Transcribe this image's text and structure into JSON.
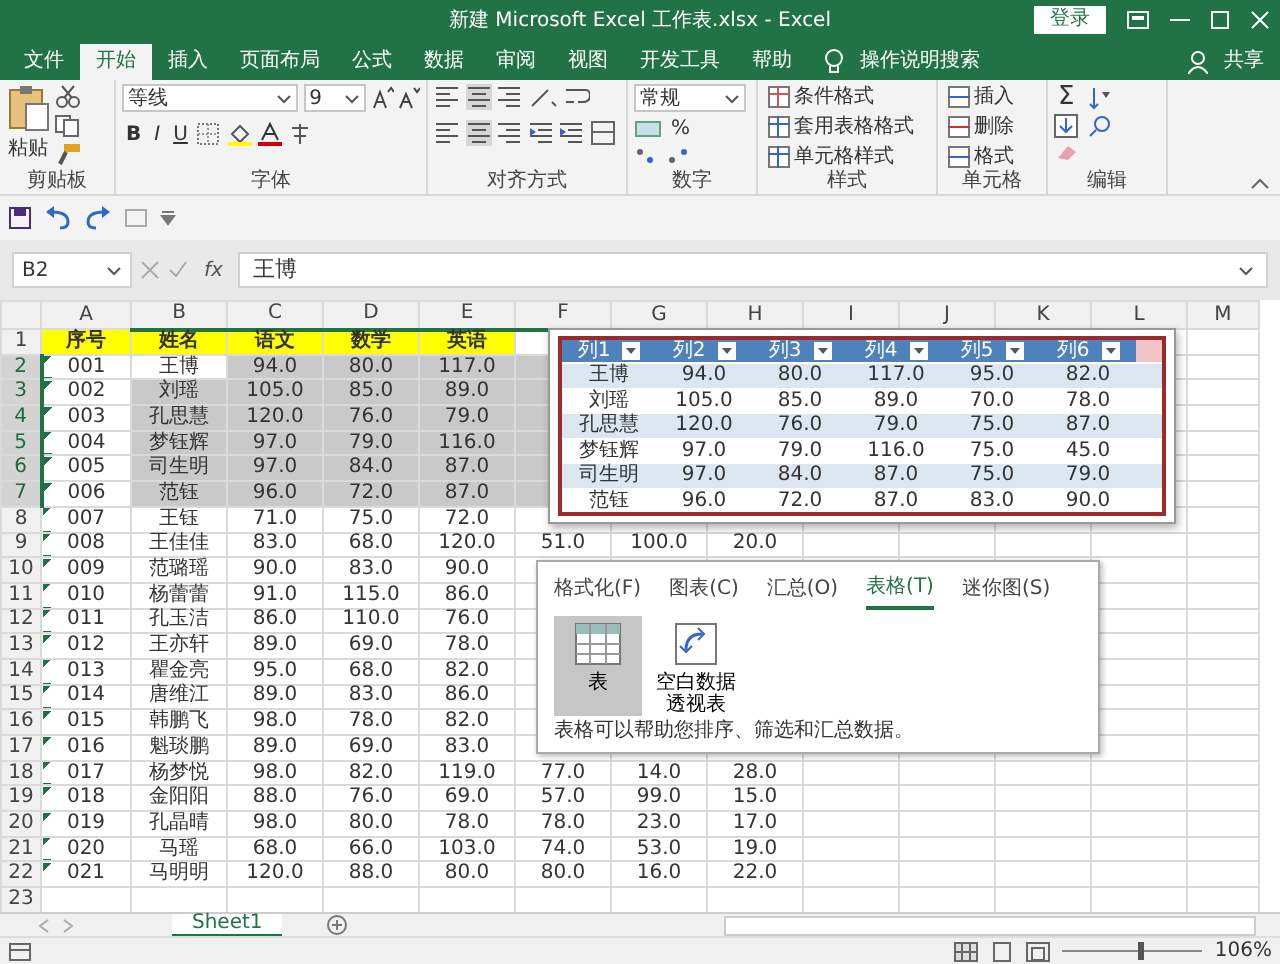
{
  "window": {
    "title": "新建 Microsoft Excel 工作表.xlsx  -  Excel",
    "sign_in": "登录"
  },
  "ribbon_tabs": [
    {
      "label": "文件",
      "selected": false
    },
    {
      "label": "开始",
      "selected": true
    },
    {
      "label": "插入",
      "selected": false
    },
    {
      "label": "页面布局",
      "selected": false
    },
    {
      "label": "公式",
      "selected": false
    },
    {
      "label": "数据",
      "selected": false
    },
    {
      "label": "审阅",
      "selected": false
    },
    {
      "label": "视图",
      "selected": false
    },
    {
      "label": "开发工具",
      "selected": false
    },
    {
      "label": "帮助",
      "selected": false
    }
  ],
  "tell_me": "操作说明搜索",
  "share": "共享",
  "ribbon": {
    "clipboard": {
      "paste": "粘贴",
      "label": "剪贴板"
    },
    "font": {
      "name": "等线",
      "size": "9",
      "styles": [
        "B",
        "I",
        "U"
      ],
      "label": "字体"
    },
    "alignment": {
      "label": "对齐方式"
    },
    "number": {
      "format": "常规",
      "percent": "%",
      "label": "数字"
    },
    "styles": {
      "items": [
        "条件格式",
        "套用表格格式",
        "单元格样式"
      ],
      "label": "样式"
    },
    "cells": {
      "items": [
        "插入",
        "删除",
        "格式"
      ],
      "label": "单元格"
    },
    "editing": {
      "sum": "Σ",
      "label": "编辑"
    }
  },
  "formula_bar": {
    "name_box": "B2",
    "function_label": "fx",
    "value": "王博"
  },
  "columns": [
    {
      "label": "A",
      "selected": false
    },
    {
      "label": "B",
      "selected": true
    },
    {
      "label": "C",
      "selected": true
    },
    {
      "label": "D",
      "selected": true
    },
    {
      "label": "E",
      "selected": true
    },
    {
      "label": "F",
      "selected": true
    },
    {
      "label": "G",
      "selected": false
    },
    {
      "label": "H",
      "selected": false
    },
    {
      "label": "I",
      "selected": false
    },
    {
      "label": "J",
      "selected": false
    },
    {
      "label": "K",
      "selected": false
    },
    {
      "label": "L",
      "selected": false
    },
    {
      "label": "M",
      "selected": false
    }
  ],
  "rows": [
    {
      "number": "1",
      "kind": "header",
      "selected": false,
      "cells": [
        "序号",
        "姓名",
        "语文",
        "数学",
        "英语"
      ]
    },
    {
      "number": "2",
      "kind": "data",
      "selected": true,
      "active": true,
      "cells": [
        "001",
        "王博",
        "94.0",
        "80.0",
        "117.0"
      ]
    },
    {
      "number": "3",
      "kind": "data",
      "selected": true,
      "cells": [
        "002",
        "刘瑶",
        "105.0",
        "85.0",
        "89.0"
      ]
    },
    {
      "number": "4",
      "kind": "data",
      "selected": true,
      "cells": [
        "003",
        "孔思慧",
        "120.0",
        "76.0",
        "79.0"
      ]
    },
    {
      "number": "5",
      "kind": "data",
      "selected": true,
      "cells": [
        "004",
        "梦钰辉",
        "97.0",
        "79.0",
        "116.0"
      ]
    },
    {
      "number": "6",
      "kind": "data",
      "selected": true,
      "cells": [
        "005",
        "司生明",
        "97.0",
        "84.0",
        "87.0"
      ]
    },
    {
      "number": "7",
      "kind": "data",
      "selected": true,
      "cells": [
        "006",
        "范钰",
        "96.0",
        "72.0",
        "87.0"
      ]
    },
    {
      "number": "8",
      "kind": "data",
      "selected": false,
      "cells": [
        "007",
        "王钰",
        "71.0",
        "75.0",
        "72.0"
      ]
    },
    {
      "number": "9",
      "kind": "data",
      "selected": false,
      "cells": [
        "008",
        "王佳佳",
        "83.0",
        "68.0",
        "120.0",
        "51.0",
        "100.0",
        "20.0"
      ]
    },
    {
      "number": "10",
      "kind": "data",
      "selected": false,
      "cells": [
        "009",
        "范璐瑶",
        "90.0",
        "83.0",
        "90.0"
      ]
    },
    {
      "number": "11",
      "kind": "data",
      "selected": false,
      "cells": [
        "010",
        "杨蕾蕾",
        "91.0",
        "115.0",
        "86.0"
      ]
    },
    {
      "number": "12",
      "kind": "data",
      "selected": false,
      "cells": [
        "011",
        "孔玉洁",
        "86.0",
        "110.0",
        "76.0"
      ]
    },
    {
      "number": "13",
      "kind": "data",
      "selected": false,
      "cells": [
        "012",
        "王亦轩",
        "89.0",
        "69.0",
        "78.0"
      ]
    },
    {
      "number": "14",
      "kind": "data",
      "selected": false,
      "cells": [
        "013",
        "瞿金亮",
        "95.0",
        "68.0",
        "82.0"
      ]
    },
    {
      "number": "15",
      "kind": "data",
      "selected": false,
      "cells": [
        "014",
        "唐维江",
        "89.0",
        "83.0",
        "86.0"
      ]
    },
    {
      "number": "16",
      "kind": "data",
      "selected": false,
      "cells": [
        "015",
        "韩鹏飞",
        "98.0",
        "78.0",
        "82.0"
      ]
    },
    {
      "number": "17",
      "kind": "data",
      "selected": false,
      "cells": [
        "016",
        "魁琰鹏",
        "89.0",
        "69.0",
        "83.0"
      ]
    },
    {
      "number": "18",
      "kind": "data",
      "selected": false,
      "cells": [
        "017",
        "杨梦悦",
        "98.0",
        "82.0",
        "119.0",
        "77.0",
        "14.0",
        "28.0"
      ]
    },
    {
      "number": "19",
      "kind": "data",
      "selected": false,
      "cells": [
        "018",
        "金阳阳",
        "88.0",
        "76.0",
        "69.0",
        "57.0",
        "99.0",
        "15.0"
      ]
    },
    {
      "number": "20",
      "kind": "data",
      "selected": false,
      "cells": [
        "019",
        "孔晶晴",
        "98.0",
        "80.0",
        "78.0",
        "78.0",
        "23.0",
        "17.0"
      ]
    },
    {
      "number": "21",
      "kind": "data",
      "selected": false,
      "cells": [
        "020",
        "马瑶",
        "68.0",
        "66.0",
        "103.0",
        "74.0",
        "53.0",
        "19.0"
      ]
    },
    {
      "number": "22",
      "kind": "data",
      "selected": false,
      "cells": [
        "021",
        "马明明",
        "120.0",
        "88.0",
        "80.0",
        "80.0",
        "16.0",
        "22.0"
      ]
    },
    {
      "number": "23",
      "kind": "empty",
      "selected": false
    }
  ],
  "table_preview": {
    "columns": [
      "列1",
      "列2",
      "列3",
      "列4",
      "列5",
      "列6"
    ],
    "rows": [
      [
        "王博",
        "94.0",
        "80.0",
        "117.0",
        "95.0",
        "82.0"
      ],
      [
        "刘瑶",
        "105.0",
        "85.0",
        "89.0",
        "70.0",
        "78.0"
      ],
      [
        "孔思慧",
        "120.0",
        "76.0",
        "79.0",
        "75.0",
        "87.0"
      ],
      [
        "梦钰辉",
        "97.0",
        "79.0",
        "116.0",
        "75.0",
        "45.0"
      ],
      [
        "司生明",
        "97.0",
        "84.0",
        "87.0",
        "75.0",
        "79.0"
      ],
      [
        "范钰",
        "96.0",
        "72.0",
        "87.0",
        "83.0",
        "90.0"
      ]
    ]
  },
  "quick_analysis": {
    "tabs": [
      {
        "label": "格式化(F)",
        "selected": false
      },
      {
        "label": "图表(C)",
        "selected": false
      },
      {
        "label": "汇总(O)",
        "selected": false
      },
      {
        "label": "表格(T)",
        "selected": true
      },
      {
        "label": "迷你图(S)",
        "selected": false
      }
    ],
    "options": [
      {
        "label": "表",
        "selected": true
      },
      {
        "label": "空白数据透视表",
        "selected": false
      }
    ],
    "description": "表格可以帮助您排序、筛选和汇总数据。"
  },
  "sheets": [
    {
      "label": "Sheet1",
      "selected": true
    }
  ],
  "status_bar": {
    "zoom": "106%",
    "zoom_slider": {
      "level": 0.53
    }
  }
}
